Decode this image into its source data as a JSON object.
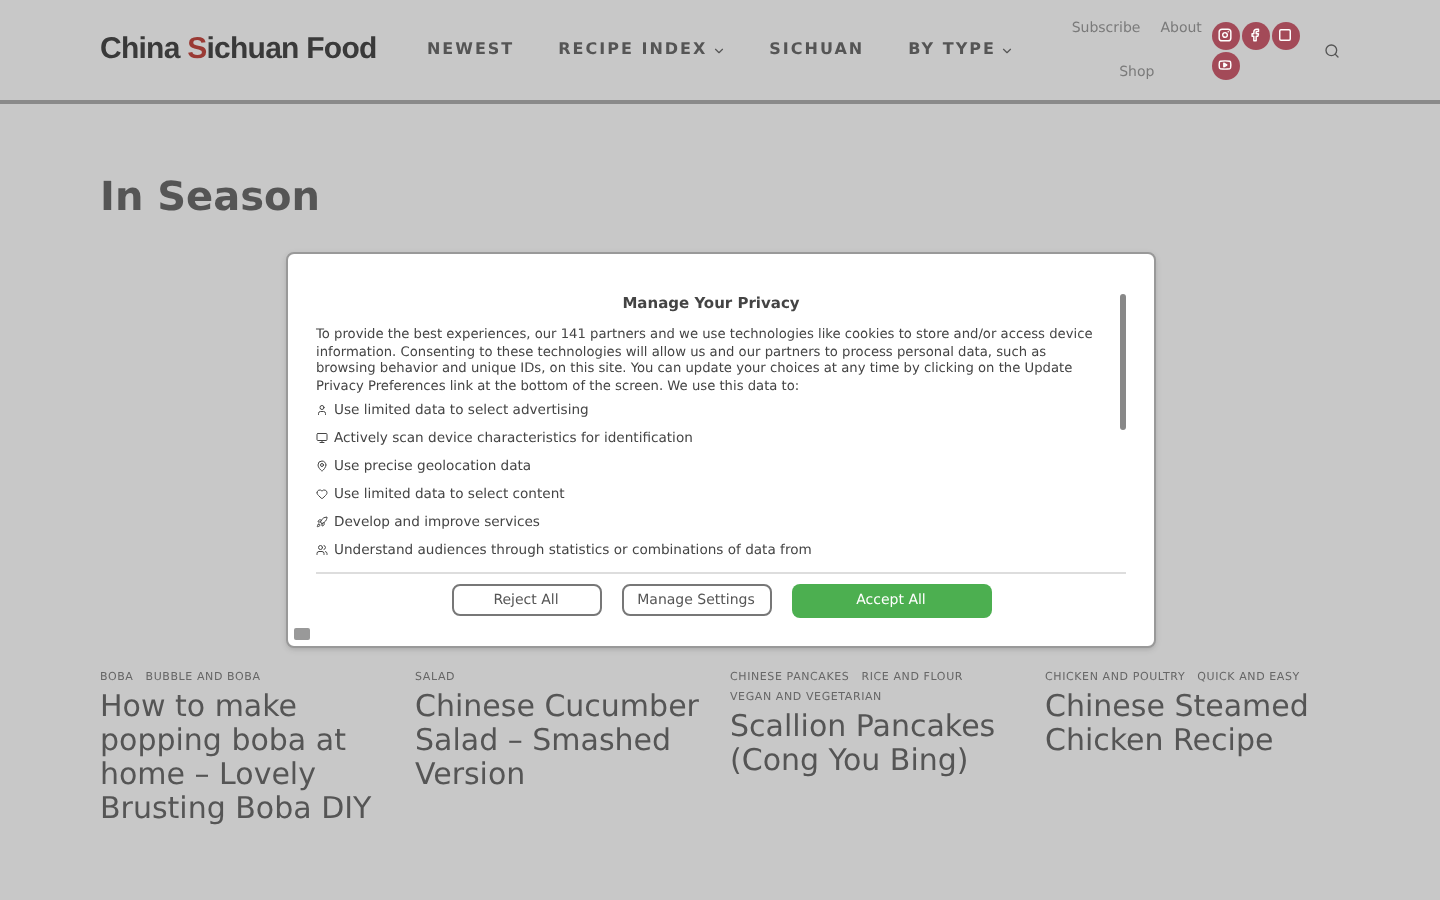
{
  "header": {
    "logo": {
      "before": "China ",
      "accent": "S",
      "after": "ichuan Food"
    },
    "nav": [
      {
        "label": "NEWEST",
        "has_dropdown": false
      },
      {
        "label": "RECIPE INDEX",
        "has_dropdown": true
      },
      {
        "label": "SICHUAN",
        "has_dropdown": false
      },
      {
        "label": "BY TYPE",
        "has_dropdown": true
      }
    ],
    "links": [
      "Subscribe",
      "About",
      "Shop"
    ],
    "social": [
      {
        "kind": "instagram"
      },
      {
        "kind": "facebook"
      },
      {
        "kind": "flipboard"
      },
      {
        "kind": "youtube"
      }
    ]
  },
  "page_title": "In Season",
  "cards": [
    {
      "tags": [
        "BOBA",
        "BUBBLE AND BOBA"
      ],
      "title": "How to make popping boba at home – Lovely Brusting Boba DIY"
    },
    {
      "tags": [
        "SALAD"
      ],
      "title": "Chinese Cucumber Salad – Smashed Version"
    },
    {
      "tags": [
        "CHINESE PANCAKES",
        "RICE AND FLOUR",
        "VEGAN AND VEGETARIAN"
      ],
      "title": "Scallion Pancakes (Cong You Bing)"
    },
    {
      "tags": [
        "CHICKEN AND POULTRY",
        "QUICK AND EASY"
      ],
      "title": "Chinese Steamed Chicken Recipe"
    }
  ],
  "privacy_dialog": {
    "title": "Manage Your Privacy",
    "body": "To provide the best experiences, our 141 partners and we use technologies like cookies to store and/or access device information. Consenting to these technologies will allow us and our partners to process personal data, such as browsing behavior and unique IDs, on this site. You can update your choices at any time by clicking on the Update Privacy Preferences link at the bottom of the screen. We use this data to:",
    "purposes": [
      {
        "kind": "advertising",
        "label": "Use limited data to select advertising"
      },
      {
        "kind": "device",
        "label": "Actively scan device characteristics for identification"
      },
      {
        "kind": "location",
        "label": "Use precise geolocation data"
      },
      {
        "kind": "content",
        "label": "Use limited data to select content"
      },
      {
        "kind": "develop",
        "label": "Develop and improve services"
      },
      {
        "kind": "audience",
        "label": "Understand audiences through statistics or combinations of data from"
      }
    ],
    "buttons": [
      {
        "kind": "outline",
        "label": "Reject All"
      },
      {
        "kind": "outline",
        "label": "Manage Settings"
      },
      {
        "kind": "primary",
        "label": "Accept All"
      }
    ]
  }
}
